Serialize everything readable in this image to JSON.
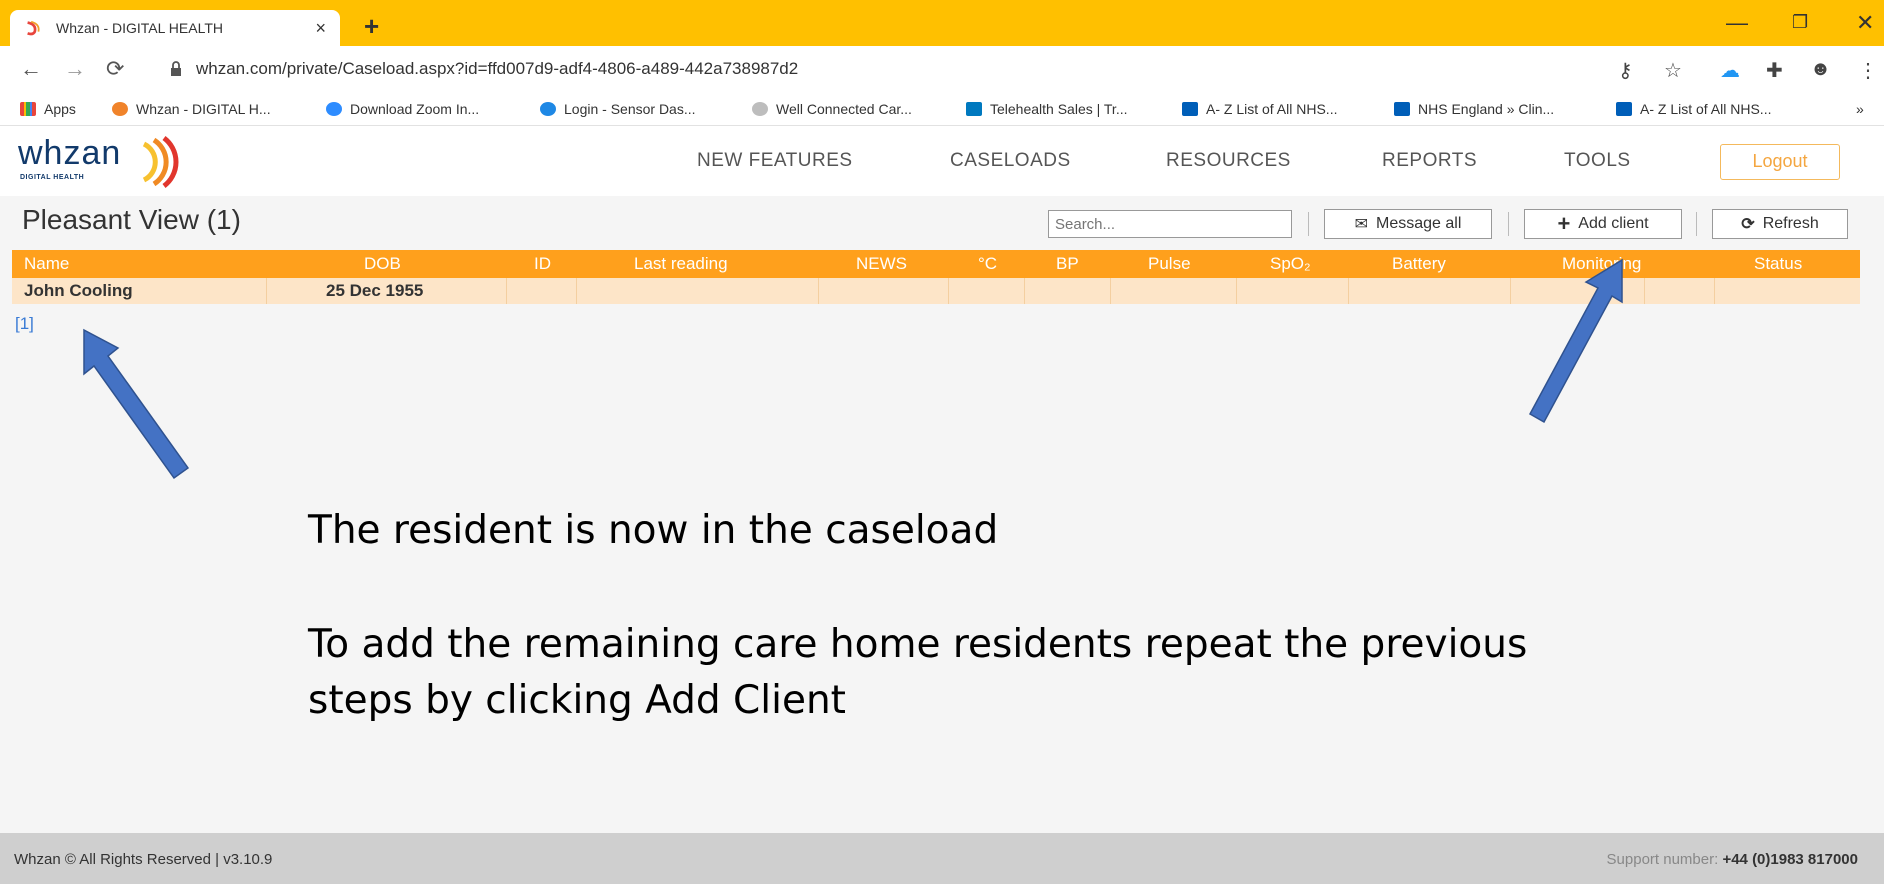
{
  "browser": {
    "tab_title": "Whzan - DIGITAL HEALTH",
    "tab_close": "×",
    "new_tab": "+",
    "url": "whzan.com/private/Caseload.aspx?id=ffd007d9-adf4-4806-a489-442a738987d2",
    "bookmarks": [
      {
        "label": "Apps",
        "icon": "apps-grid-icon",
        "color": "#e8453c"
      },
      {
        "label": "Whzan - DIGITAL H...",
        "icon": "whzan-icon",
        "color": "#f0832a"
      },
      {
        "label": "Download Zoom In...",
        "icon": "zoom-icon",
        "color": "#2d8cff"
      },
      {
        "label": "Login - Sensor Das...",
        "icon": "sensor-icon",
        "color": "#1e88e5"
      },
      {
        "label": "Well Connected Car...",
        "icon": "globe-icon",
        "color": "#9e9e9e"
      },
      {
        "label": "Telehealth Sales | Tr...",
        "icon": "trello-icon",
        "color": "#0079bf"
      },
      {
        "label": "A- Z List of All NHS...",
        "icon": "nhs-icon",
        "color": "#005eb8"
      },
      {
        "label": "NHS England » Clin...",
        "icon": "nhs-icon",
        "color": "#005eb8"
      },
      {
        "label": "A- Z List of All NHS...",
        "icon": "nhs-icon",
        "color": "#005eb8"
      }
    ],
    "more": "»"
  },
  "app": {
    "logo_text": "whzan",
    "logo_sub": "DIGITAL HEALTH",
    "nav": [
      "NEW FEATURES",
      "CASELOADS",
      "RESOURCES",
      "REPORTS",
      "TOOLS"
    ],
    "logout": "Logout"
  },
  "caseload": {
    "title": "Pleasant View (1)",
    "search_placeholder": "Search...",
    "message_all": "Message all",
    "add_client": "Add client",
    "refresh": "Refresh",
    "columns": [
      "Name",
      "DOB",
      "ID",
      "Last reading",
      "NEWS",
      "°C",
      "BP",
      "Pulse",
      "SpO₂",
      "Battery",
      "Monitoring",
      "Status"
    ],
    "rows": [
      {
        "name": "John Cooling",
        "dob": "25 Dec 1955"
      }
    ],
    "pager": "[1]"
  },
  "instructions": {
    "line1": "The resident is now in the caseload",
    "line2": "To add the remaining care home residents repeat the previous",
    "line3": "steps by clicking Add Client"
  },
  "footer": {
    "copyright": "Whzan © All Rights Reserved | v3.10.9",
    "support_label": "Support number:",
    "support_number": "+44 (0)1983 817000"
  },
  "colors": {
    "tabbar": "#ffc000",
    "table_header": "#ffa01c",
    "row_bg": "#fde5c8",
    "arrow": "#4472c4"
  }
}
